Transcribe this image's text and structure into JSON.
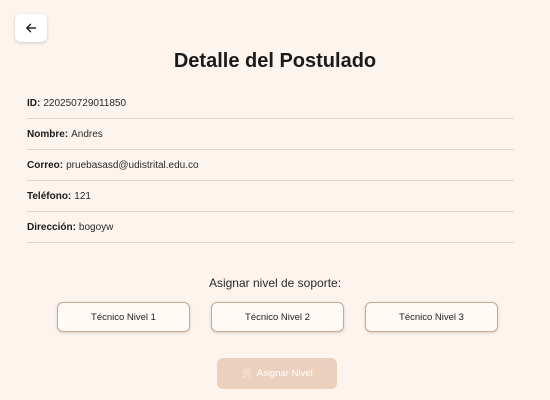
{
  "header": {
    "title": "Detalle del Postulado",
    "back_icon": "arrow-left-icon"
  },
  "details": [
    {
      "label": "ID:",
      "value": "220250729011850"
    },
    {
      "label": "Nombre:",
      "value": "Andres"
    },
    {
      "label": "Correo:",
      "value": "pruebasasd@udistrital.edu.co"
    },
    {
      "label": "Teléfono:",
      "value": "121"
    },
    {
      "label": "Dirección:",
      "value": "bogoyw"
    }
  ],
  "support": {
    "label": "Asignar nivel de soporte:",
    "levels": [
      "Técnico Nivel 1",
      "Técnico Nivel 2",
      "Técnico Nivel 3"
    ]
  },
  "assign": {
    "label": "Asignar Nivel",
    "icon": "tools-icon",
    "disabled": true
  },
  "colors": {
    "background": "#fdf4ee",
    "level_button_border": "#c9a990",
    "assign_button_disabled": "#ebd1bd"
  }
}
